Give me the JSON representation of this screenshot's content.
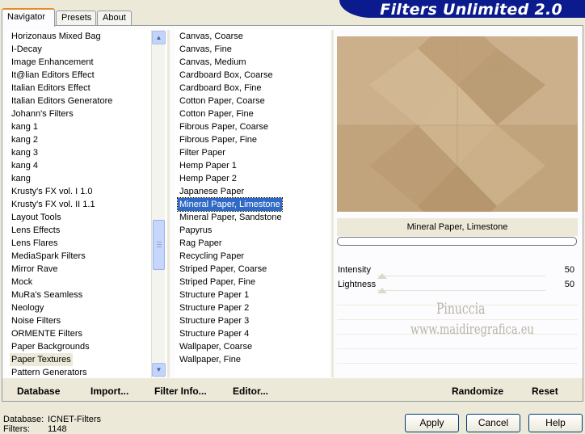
{
  "title": "Filters Unlimited 2.0",
  "tabs": [
    {
      "label": "Navigator"
    },
    {
      "label": "Presets"
    },
    {
      "label": "About"
    }
  ],
  "categories": [
    "Horizonaus Mixed Bag",
    "I-Decay",
    "Image Enhancement",
    "It@lian Editors Effect",
    "Italian Editors Effect",
    "Italian Editors Generatore",
    "Johann's Filters",
    "kang 1",
    "kang 2",
    "kang 3",
    "kang 4",
    "kang",
    "Krusty's FX vol. I 1.0",
    "Krusty's FX vol. II 1.1",
    "Layout Tools",
    "Lens Effects",
    "Lens Flares",
    "MediaSpark Filters",
    "Mirror Rave",
    "Mock",
    "MuRa's Seamless",
    "Neology",
    "Noise Filters",
    "ORMENTE Filters",
    "Paper Backgrounds",
    "Paper Textures",
    "Pattern Generators"
  ],
  "selected_category": "Paper Textures",
  "filters": [
    "Canvas, Coarse",
    "Canvas, Fine",
    "Canvas, Medium",
    "Cardboard Box, Coarse",
    "Cardboard Box, Fine",
    "Cotton Paper, Coarse",
    "Cotton Paper, Fine",
    "Fibrous Paper, Coarse",
    "Fibrous Paper, Fine",
    "Filter Paper",
    "Hemp Paper 1",
    "Hemp Paper 2",
    "Japanese Paper",
    "Mineral Paper, Limestone",
    "Mineral Paper, Sandstone",
    "Papyrus",
    "Rag Paper",
    "Recycling Paper",
    "Striped Paper, Coarse",
    "Striped Paper, Fine",
    "Structure Paper 1",
    "Structure Paper 2",
    "Structure Paper 3",
    "Structure Paper 4",
    "Wallpaper, Coarse",
    "Wallpaper, Fine"
  ],
  "selected_filter": "Mineral Paper, Limestone",
  "preview_label": "Mineral Paper, Limestone",
  "sliders": [
    {
      "name": "Intensity",
      "value": "50"
    },
    {
      "name": "Lightness",
      "value": "50"
    }
  ],
  "watermark": {
    "line1": "Pinuccia",
    "line2": "www.maidiregrafica.eu"
  },
  "toolbar": {
    "database": "Database",
    "import": "Import...",
    "filter_info": "Filter Info...",
    "editor": "Editor...",
    "randomize": "Randomize",
    "reset": "Reset"
  },
  "info": {
    "database_label": "Database:",
    "database_value": "ICNET-Filters",
    "filters_label": "Filters:",
    "filters_value": "1148"
  },
  "buttons": {
    "apply": "Apply",
    "cancel": "Cancel",
    "help": "Help"
  },
  "colors": {
    "banner": "#0b1a8c",
    "selection": "#316ac5",
    "preview": "#c6a77f"
  }
}
